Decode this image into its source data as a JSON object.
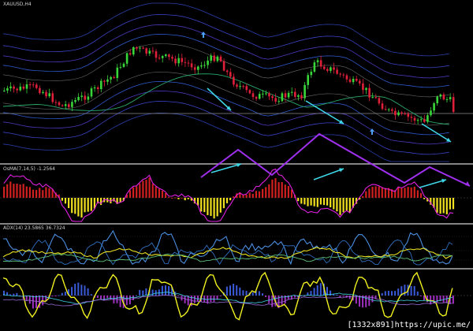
{
  "chart_window": {
    "symbol_title": "XAUUSD,H4"
  },
  "panels": {
    "indicator_1_label": "OsMA(7,14,5) -1.2564",
    "indicator_2_label": "ADX(14) 23.5865 36.7324",
    "indicator_3_label": ""
  },
  "watermark": "[1332x891]https://upic.me/",
  "colors": {
    "background": "#000000",
    "bull_candle": "#39d639",
    "bear_candle": "#e0203a",
    "arrow_cyan": "#3fd6e8",
    "zigzag_purple": "#a030f0",
    "osma_magenta": "#e020e0",
    "hist_red": "#d02020",
    "hist_yellow": "#f0e020",
    "adx_blue": "#4a8ee0",
    "adx_yellow": "#e8e020",
    "stoch_yellow": "#f0f020",
    "separator": "#b0b0b0"
  },
  "icons": [
    "up-arrow-signal-icon",
    "down-arrow-signal-icon",
    "cyan-arrow-icon"
  ]
}
